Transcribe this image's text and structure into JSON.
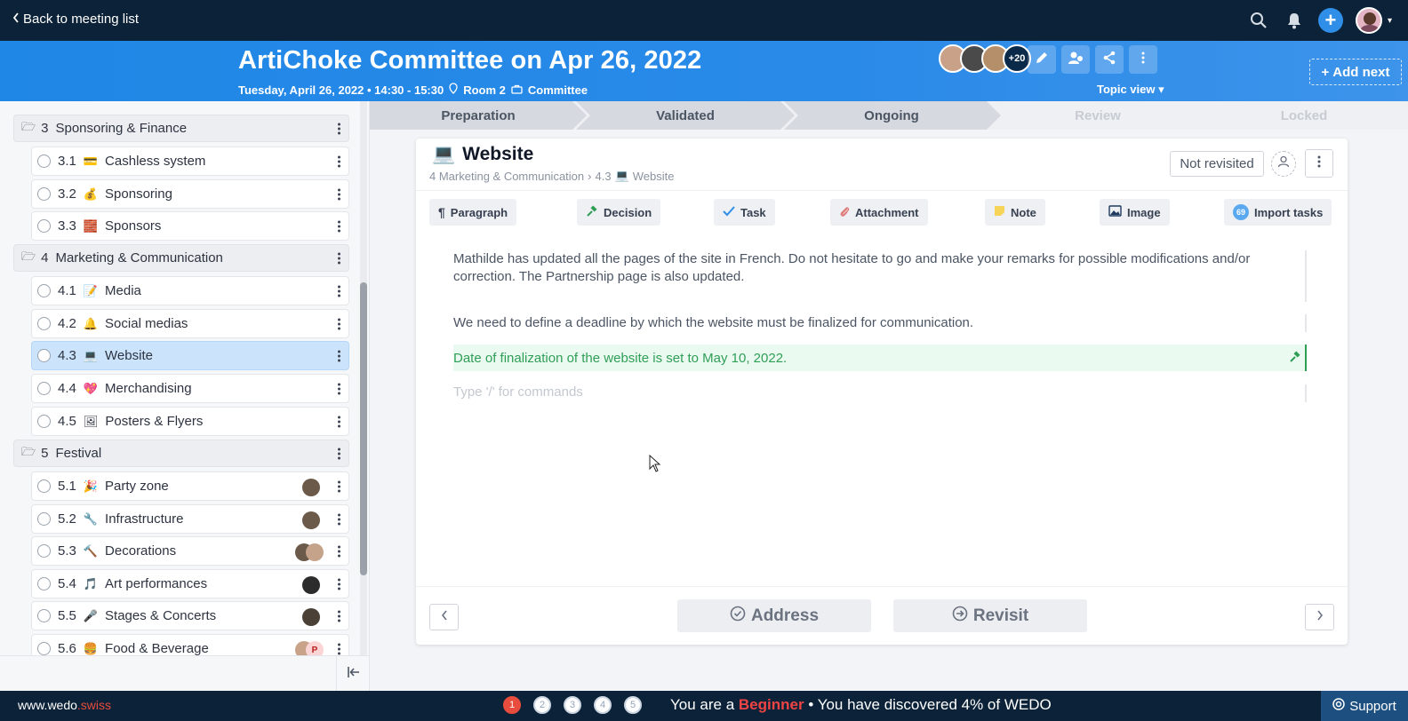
{
  "topbar": {
    "back_label": "Back to meeting list",
    "icons": [
      "search-icon",
      "bell-icon",
      "plus-icon",
      "user-avatar"
    ]
  },
  "header": {
    "title": "ArtiChoke Committee on Apr 26, 2022",
    "date_time": "Tuesday, April 26, 2022 • 14:30 - 15:30",
    "room": "Room 2",
    "group": "Committee",
    "participants_more": "+20",
    "topic_view": "Topic view",
    "add_next": "Add next"
  },
  "sidebar": {
    "sections": [
      {
        "num": "3",
        "label": "Sponsoring & Finance"
      },
      {
        "num": "4",
        "label": "Marketing & Communication"
      },
      {
        "num": "5",
        "label": "Festival"
      }
    ],
    "items": [
      {
        "num": "3.1",
        "emoji": "💳",
        "label": "Cashless system"
      },
      {
        "num": "3.2",
        "emoji": "💰",
        "label": "Sponsoring"
      },
      {
        "num": "3.3",
        "emoji": "🧱",
        "label": "Sponsors"
      },
      {
        "num": "4.1",
        "emoji": "📝",
        "label": "Media"
      },
      {
        "num": "4.2",
        "emoji": "🔔",
        "label": "Social medias"
      },
      {
        "num": "4.3",
        "emoji": "💻",
        "label": "Website"
      },
      {
        "num": "4.4",
        "emoji": "💖",
        "label": "Merchandising"
      },
      {
        "num": "4.5",
        "emoji": "🖼",
        "label": "Posters & Flyers"
      },
      {
        "num": "5.1",
        "emoji": "🎉",
        "label": "Party zone"
      },
      {
        "num": "5.2",
        "emoji": "🔧",
        "label": "Infrastructure"
      },
      {
        "num": "5.3",
        "emoji": "🔨",
        "label": "Decorations"
      },
      {
        "num": "5.4",
        "emoji": "🎵",
        "label": "Art performances"
      },
      {
        "num": "5.5",
        "emoji": "🎤",
        "label": "Stages & Concerts"
      },
      {
        "num": "5.6",
        "emoji": "🍔",
        "label": "Food & Beverage"
      }
    ],
    "avatar_letter": "P"
  },
  "stepper": [
    "Preparation",
    "Validated",
    "Ongoing",
    "Review",
    "Locked"
  ],
  "topic": {
    "emoji": "💻",
    "title": "Website",
    "breadcrumb_parent": "4 Marketing & Communication",
    "breadcrumb_sep": "›",
    "breadcrumb_num": "4.3",
    "breadcrumb_current": "Website",
    "status": "Not revisited"
  },
  "toolbar": {
    "paragraph": "Paragraph",
    "decision": "Decision",
    "task": "Task",
    "attachment": "Attachment",
    "note": "Note",
    "image": "Image",
    "import_count": "69",
    "import": "Import tasks"
  },
  "content": {
    "para1": "Mathilde has updated all the pages of the site in French. Do not hesitate to go and make your remarks for possible modifications and/or correction. The Partnership page is also updated.",
    "para2": "We need to define a deadline by which the website must be finalized for communication.",
    "decision": "Date of finalization of the website is set to May 10, 2022.",
    "placeholder": "Type '/' for commands"
  },
  "actions": {
    "address": "Address",
    "revisit": "Revisit"
  },
  "footer": {
    "brand_main": "www.wedo",
    "brand_dot": ".swiss",
    "levels": [
      "1",
      "2",
      "3",
      "4",
      "5"
    ],
    "msg_prefix": "You are a",
    "level_name": "Beginner",
    "msg_suffix": "• You have discovered 4% of WEDO",
    "support": "Support"
  },
  "colors": {
    "topbar": "#0b2238",
    "header": "#1f87e6",
    "active_item": "#cbe4fc",
    "decision_bg": "#eafaf0",
    "decision_text": "#2f9e57",
    "level_accent": "#e74c3c"
  }
}
